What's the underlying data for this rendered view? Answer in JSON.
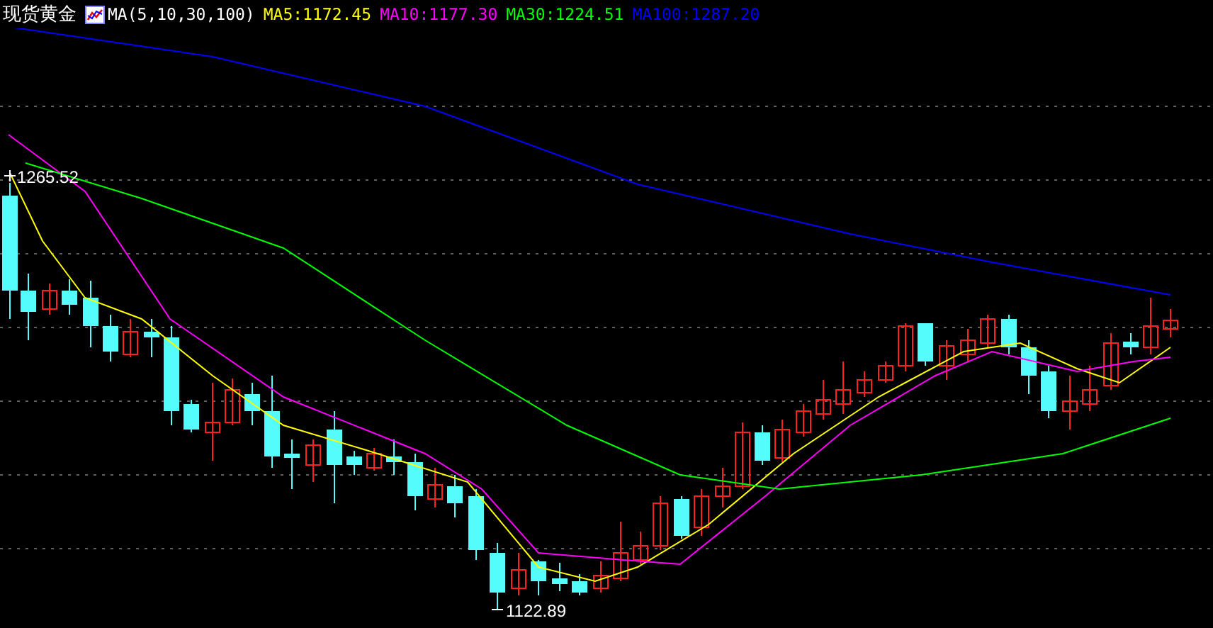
{
  "header": {
    "title": "现货黄金",
    "indicator": "MA(5,10,30,100)",
    "ma_values": [
      {
        "label": "MA5:1172.45",
        "color": "#ffff00"
      },
      {
        "label": "MA10:1177.30",
        "color": "#ff00ff"
      },
      {
        "label": "MA30:1224.51",
        "color": "#00ff00"
      },
      {
        "label": "MA100:1287.20",
        "color": "#0000ff"
      }
    ]
  },
  "chart": {
    "high_label": "1265.52",
    "low_label": "1122.89"
  }
}
